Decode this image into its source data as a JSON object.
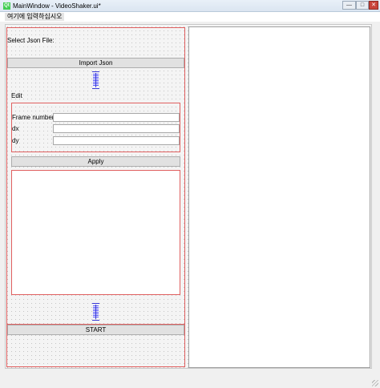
{
  "window": {
    "title": "MainWindow - VideoShaker.ui*",
    "logo_text": "Qt",
    "controls": {
      "minimize": "—",
      "maximize": "□",
      "close": "✕"
    }
  },
  "menubar": {
    "placeholder_item": "여기에 입력하십시오"
  },
  "left": {
    "select_label": "Select Json File:",
    "import_button": "Import Json",
    "edit_label": "Edit",
    "form": {
      "frame_number_label": "Frame number",
      "dx_label": "dx",
      "dy_label": "dy",
      "frame_number_value": "",
      "dx_value": "",
      "dy_value": ""
    },
    "apply_button": "Apply",
    "start_button": "START"
  },
  "colors": {
    "layout_border": "#e06060",
    "spacer": "#3b3bd6",
    "qt_green": "#41cd52"
  }
}
